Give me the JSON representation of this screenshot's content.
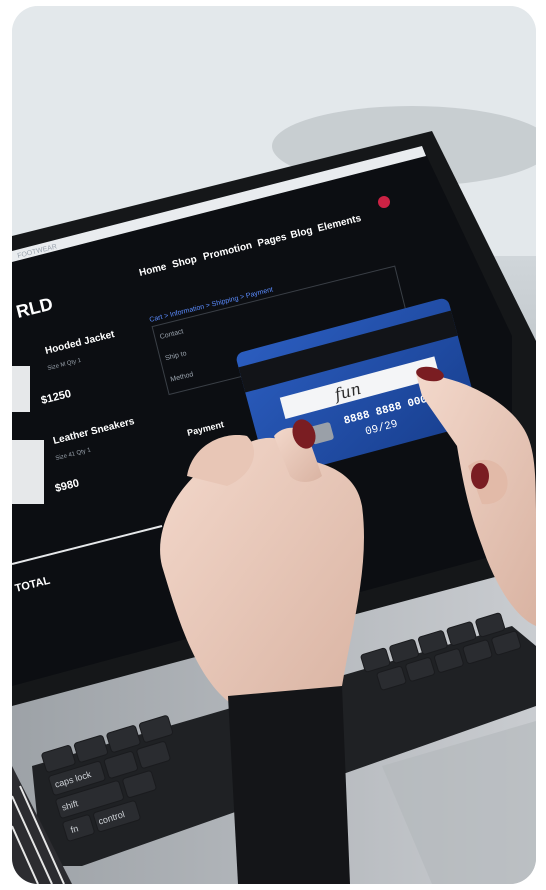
{
  "laptop_screen": {
    "brand": "FOOTWEAR",
    "nav": [
      "Home",
      "Shop",
      "Promotion",
      "Pages",
      "Blog",
      "Elements"
    ],
    "store_name": "RLD",
    "breadcrumb": "Cart > Information > Shipping > Payment",
    "field_labels": [
      "Contact",
      "Ship to",
      "Method"
    ],
    "payment_label": "Payment",
    "products": [
      {
        "name": "Hooded Jacket",
        "meta": "Size M    Qty 1",
        "price": "$1250"
      },
      {
        "name": "Leather Sneakers",
        "meta": "Size 41    Qty 1",
        "price": "$980"
      }
    ],
    "total_label": "TOTAL"
  },
  "credit_card": {
    "number": "8888 8888 0000 5",
    "expiry": "09/29",
    "signature": "fun"
  },
  "keyboard": {
    "keys": [
      "caps lock",
      "shift",
      "control",
      "fn"
    ]
  },
  "colors": {
    "card_blue": "#1f4fa8",
    "screen_bg": "#0c0e12",
    "nail_red": "#7a1d22"
  }
}
